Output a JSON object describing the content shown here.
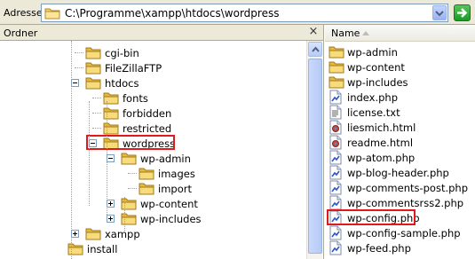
{
  "address": {
    "label": "Adresse",
    "path": "C:\\Programme\\xampp\\htdocs\\wordpress"
  },
  "left_pane": {
    "header": "Ordner",
    "close_glyph": "×",
    "tree": [
      {
        "label": "cgi-bin",
        "indent": 1,
        "toggle": "none",
        "highlighted": false
      },
      {
        "label": "FileZillaFTP",
        "indent": 1,
        "toggle": "none",
        "highlighted": false
      },
      {
        "label": "htdocs",
        "indent": 1,
        "toggle": "minus",
        "highlighted": false
      },
      {
        "label": "fonts",
        "indent": 2,
        "toggle": "none",
        "highlighted": false
      },
      {
        "label": "forbidden",
        "indent": 2,
        "toggle": "none",
        "highlighted": false
      },
      {
        "label": "restricted",
        "indent": 2,
        "toggle": "none",
        "highlighted": false
      },
      {
        "label": "wordpress",
        "indent": 2,
        "toggle": "minus",
        "highlighted": true
      },
      {
        "label": "wp-admin",
        "indent": 3,
        "toggle": "minus",
        "highlighted": false
      },
      {
        "label": "images",
        "indent": 4,
        "toggle": "none",
        "highlighted": false
      },
      {
        "label": "import",
        "indent": 4,
        "toggle": "none",
        "highlighted": false
      },
      {
        "label": "wp-content",
        "indent": 3,
        "toggle": "plus",
        "highlighted": false
      },
      {
        "label": "wp-includes",
        "indent": 3,
        "toggle": "plus",
        "highlighted": false
      },
      {
        "label": "xampp",
        "indent": 1,
        "toggle": "plus",
        "highlighted": false
      },
      {
        "label": "install",
        "indent": 0,
        "toggle": "none",
        "highlighted": false
      }
    ]
  },
  "right_pane": {
    "column_header": "Name",
    "files": [
      {
        "name": "wp-admin",
        "type": "folder",
        "highlighted": false
      },
      {
        "name": "wp-content",
        "type": "folder",
        "highlighted": false
      },
      {
        "name": "wp-includes",
        "type": "folder",
        "highlighted": false
      },
      {
        "name": "index.php",
        "type": "php",
        "highlighted": false
      },
      {
        "name": "license.txt",
        "type": "txt",
        "highlighted": false
      },
      {
        "name": "liesmich.html",
        "type": "html",
        "highlighted": false
      },
      {
        "name": "readme.html",
        "type": "html",
        "highlighted": false
      },
      {
        "name": "wp-atom.php",
        "type": "php",
        "highlighted": false
      },
      {
        "name": "wp-blog-header.php",
        "type": "php",
        "highlighted": false
      },
      {
        "name": "wp-comments-post.php",
        "type": "php",
        "highlighted": false
      },
      {
        "name": "wp-commentsrss2.php",
        "type": "php",
        "highlighted": false
      },
      {
        "name": "wp-config.php",
        "type": "php",
        "highlighted": true
      },
      {
        "name": "wp-config-sample.php",
        "type": "php",
        "highlighted": false
      },
      {
        "name": "wp-feed.php",
        "type": "php",
        "highlighted": false
      }
    ]
  },
  "colors": {
    "highlight_box": "#e0191b",
    "folder": "#f5d56b",
    "chrome": "#ece9d8"
  }
}
